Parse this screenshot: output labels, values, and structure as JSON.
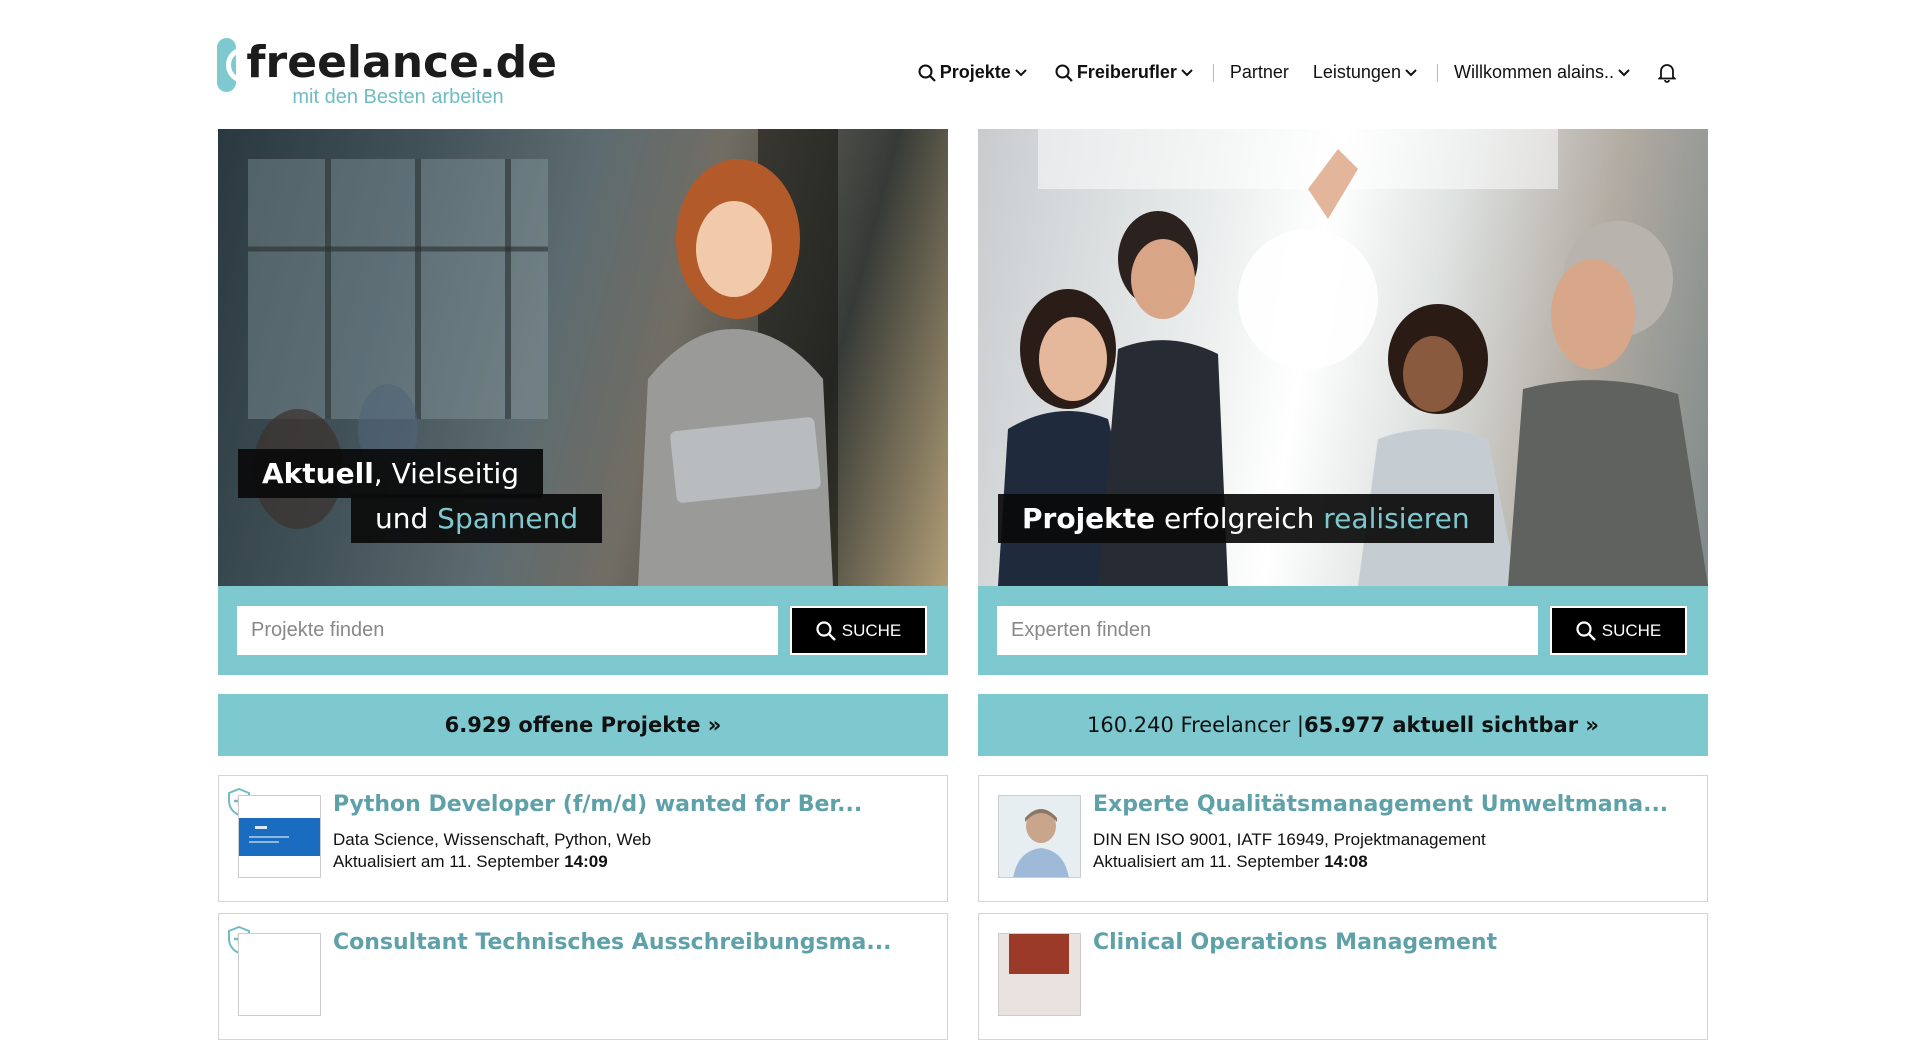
{
  "brand": {
    "name": "freelance.de",
    "tagline": "mit den Besten arbeiten",
    "accent_color": "#7ec8cf",
    "title_color": "#5fa1a9"
  },
  "nav": {
    "projekte": "Projekte",
    "freiberufler": "Freiberufler",
    "partner": "Partner",
    "leistungen": "Leistungen",
    "account": "Willkommen alains..",
    "notifications_icon": "bell-icon"
  },
  "left": {
    "hero_line1_bold": "Aktuell",
    "hero_line1_rest": ", Vielseitig",
    "hero_line2_prefix": "und ",
    "hero_line2_accent": "Spannend",
    "search_placeholder": "Projekte finden",
    "search_button": "SUCHE",
    "count_text": "6.929 offene Projekte »",
    "cards": [
      {
        "title": "Python Developer (f/m/d) wanted for Ber...",
        "tags": "Data Science, Wissenschaft, Python, Web",
        "updated_prefix": "Aktualisiert am 11. September ",
        "updated_time": "14:09"
      },
      {
        "title": "Consultant Technisches Ausschreibungsma..."
      }
    ]
  },
  "right": {
    "hero_bold": "Projekte",
    "hero_mid": " erfolgreich ",
    "hero_accent": "realisieren",
    "search_placeholder": "Experten finden",
    "search_button": "SUCHE",
    "count_prefix": "160.240 Freelancer | ",
    "count_bold": "65.977 aktuell sichtbar »",
    "cards": [
      {
        "title": "Experte Qualitätsmanagement Umweltmana...",
        "tags": "DIN EN ISO 9001, IATF 16949, Projektmanagement",
        "updated_prefix": "Aktualisiert am 11. September ",
        "updated_time": "14:08"
      },
      {
        "title": "Clinical Operations Management"
      }
    ]
  }
}
